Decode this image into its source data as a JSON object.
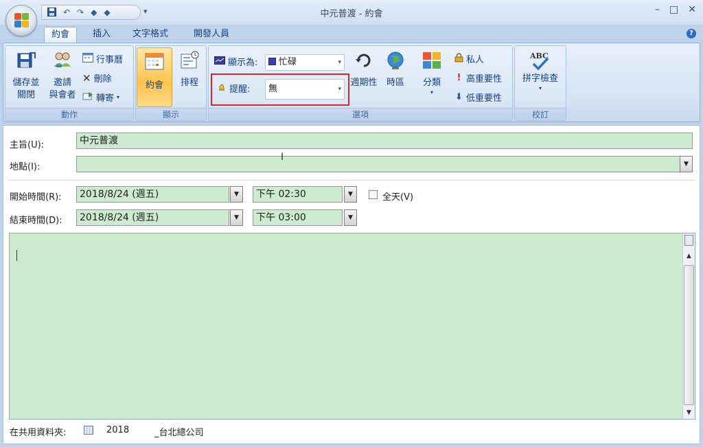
{
  "window": {
    "title": "中元普渡 - 約會",
    "controls": [
      "–",
      "□",
      "✕"
    ]
  },
  "quick_access": {
    "icons": [
      "save-icon",
      "undo-icon",
      "redo-icon",
      "up-arrow-icon",
      "down-arrow-icon"
    ],
    "customize": "▾"
  },
  "tabs": [
    {
      "label": "約會",
      "active": true
    },
    {
      "label": "插入",
      "active": false
    },
    {
      "label": "文字格式",
      "active": false
    },
    {
      "label": "開發人員",
      "active": false
    }
  ],
  "ribbon": {
    "actions": {
      "label": "動作",
      "save_close": [
        "儲存並",
        "關閉"
      ],
      "invite": [
        "邀請",
        "與會者"
      ],
      "calendar": "行事曆",
      "delete": "刪除",
      "forward": "轉寄"
    },
    "show": {
      "label": "顯示",
      "appointment": "約會",
      "scheduling": "排程"
    },
    "options": {
      "label": "選項",
      "show_as_label": "顯示為:",
      "show_as_value": "忙碌",
      "reminder_label": "提醒:",
      "reminder_value": "無",
      "recurrence": "週期性",
      "time_zones": "時區",
      "categorize": "分類",
      "private": "私人",
      "high_importance": "高重要性",
      "low_importance": "低重要性"
    },
    "proofing": {
      "label": "校訂",
      "spelling": "拼字檢查",
      "abc": "ABC"
    }
  },
  "form": {
    "subject_label": "主旨(U):",
    "subject_value": "中元普渡",
    "location_label": "地點(I):",
    "location_value": "",
    "start_label": "開始時間(R):",
    "start_date": "2018/8/24 (週五)",
    "start_time": "下午 02:30",
    "end_label": "結束時間(D):",
    "end_date": "2018/8/24 (週五)",
    "end_time": "下午 03:00",
    "all_day_label": "全天(V)",
    "all_day_checked": false,
    "shared_folder_label": "在共用資料夾:",
    "shared_folder_prefix": "2018",
    "shared_folder_suffix": "_台北總公司"
  },
  "colors": {
    "field_green": "#ccebcf",
    "ribbon_text": "#15428b",
    "highlight_red": "#d4292b"
  }
}
